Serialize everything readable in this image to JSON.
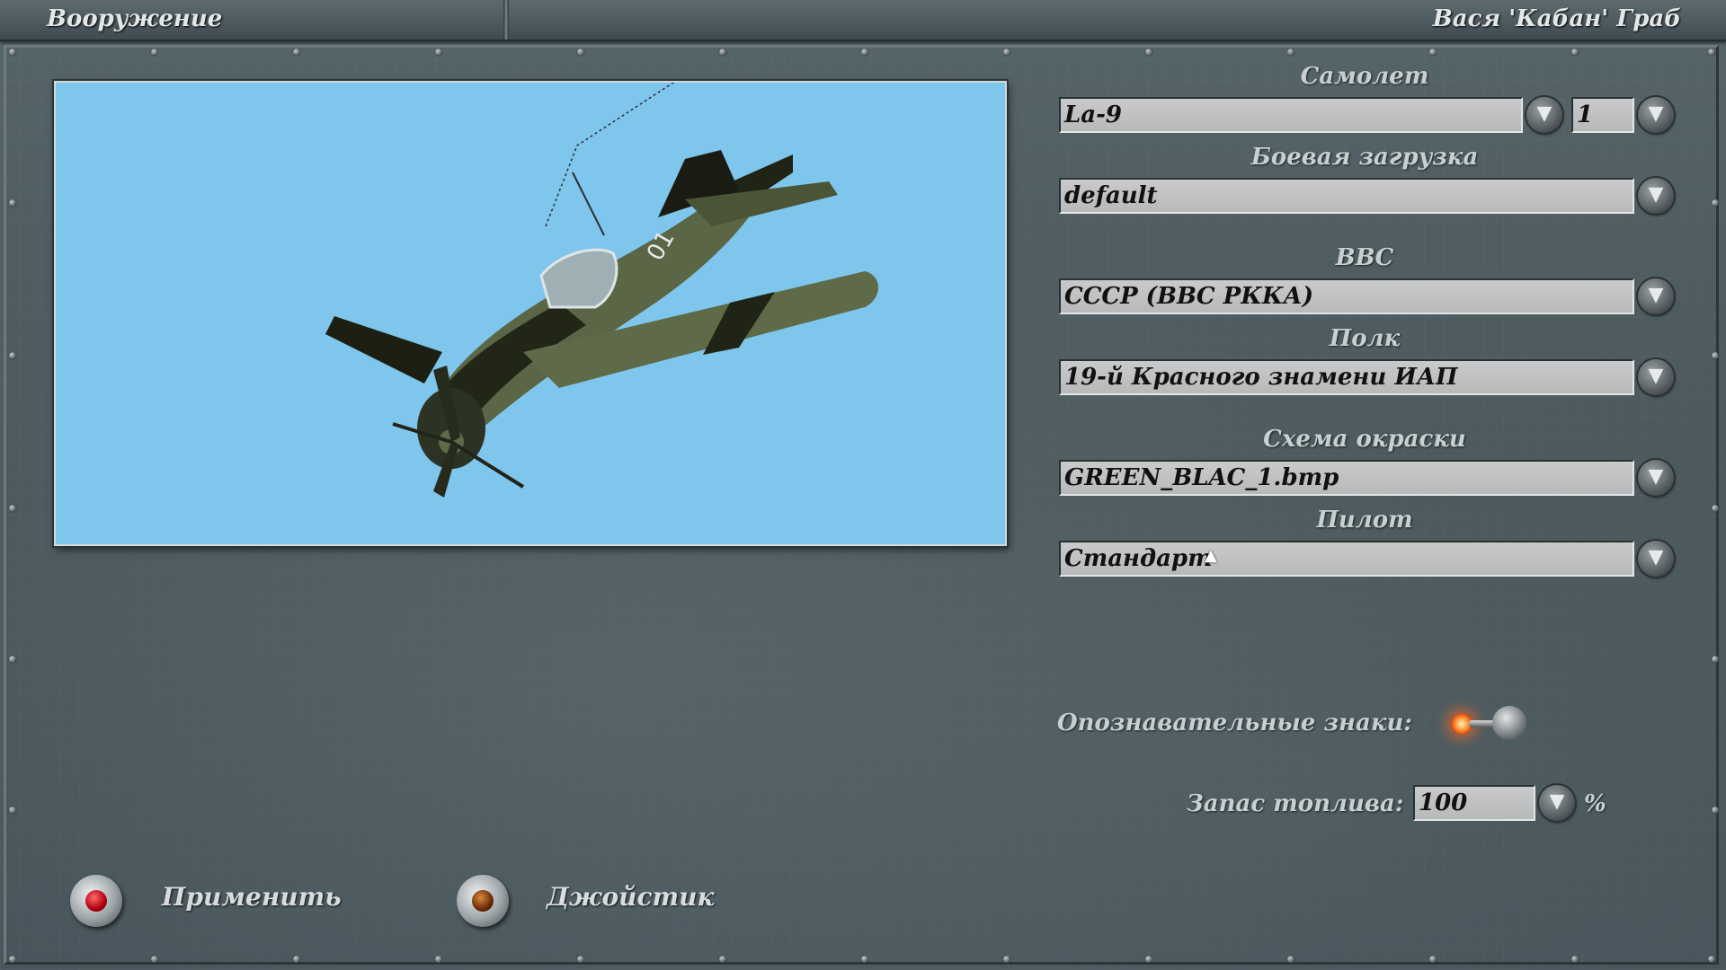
{
  "header": {
    "screen_title": "Вооружение",
    "user_name": "Вася 'Кабан' Граб"
  },
  "form": {
    "aircraft": {
      "label": "Самолет",
      "value": "La-9",
      "count": "1"
    },
    "loadout": {
      "label": "Боевая загрузка",
      "value": "default"
    },
    "air_force": {
      "label": "ВВС",
      "value": "СССР (ВВС РККА)"
    },
    "regiment": {
      "label": "Полк",
      "value": "19-й Красного знамени ИАП"
    },
    "skin": {
      "label": "Схема окраски",
      "value": "GREEN_BLAC_1.bmp"
    },
    "pilot": {
      "label": "Пилот",
      "value": "Стандарт"
    },
    "markings": {
      "label": "Опознавательные знаки:",
      "state": "on"
    },
    "fuel": {
      "label": "Запас топлива:",
      "value": "100",
      "unit": "%"
    }
  },
  "preview": {
    "sky_color": "#7fc6ec",
    "tail_number": "01"
  },
  "buttons": {
    "apply": "Применить",
    "joystick": "Джойстик"
  },
  "icons": {
    "dropdown": "chevron-down-icon",
    "toggle": "toggle-switch-icon"
  },
  "dropdown_glyph": "▼"
}
